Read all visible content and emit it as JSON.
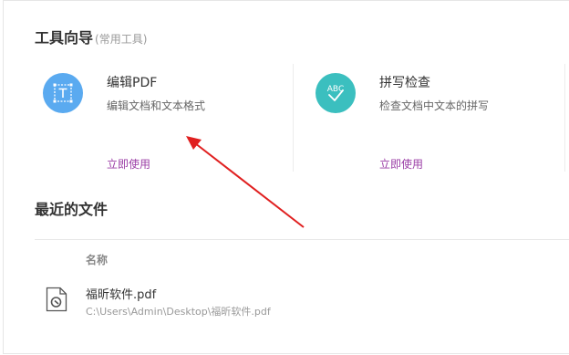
{
  "tools_section": {
    "title": "工具向导",
    "subtitle": "(常用工具)",
    "tools": [
      {
        "name": "编辑PDF",
        "desc": "编辑文档和文本格式",
        "use_label": "立即使用",
        "icon": "edit-text-icon",
        "color": "#5aaaf0"
      },
      {
        "name": "拼写检查",
        "desc": "检查文档中文本的拼写",
        "use_label": "立即使用",
        "icon": "spellcheck-icon",
        "color": "#3bbfbf"
      }
    ]
  },
  "recent": {
    "title": "最近的文件",
    "column_name": "名称",
    "files": [
      {
        "name": "福昕软件.pdf",
        "path": "C:\\Users\\Admin\\Desktop\\福昕软件.pdf",
        "icon": "pdf-file-icon"
      }
    ]
  },
  "annotation": {
    "color": "#e02020"
  }
}
